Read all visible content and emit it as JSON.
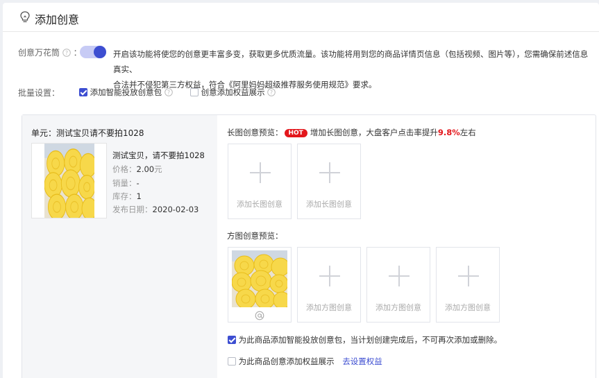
{
  "header": {
    "title": "添加创意",
    "icon": "lightbulb-icon"
  },
  "kaleidoscope": {
    "label": "创意万花筒",
    "suffix": "：",
    "enabled": true,
    "desc_line1": "开启该功能将使您的创意更丰富多变，获取更多优质流量。该功能将用到您的商品详情页信息（包括视频、图片等），您需确保前述信息真实、",
    "desc_line2": "合法并不侵犯第三方权益，符合《阿里妈妈超级推荐服务使用规范》要求。"
  },
  "batch": {
    "label": "批量设置：",
    "option1": {
      "label": "添加智能投放创意包",
      "checked": true
    },
    "option2": {
      "label": "创意添加权益展示",
      "checked": false
    }
  },
  "unit": {
    "title": "单元：测试宝贝请不要拍1028",
    "product": {
      "name": "测试宝贝，请不要拍1028",
      "price_label": "价格：",
      "price_value": "2.00",
      "price_unit": "元",
      "sales_label": "销量：",
      "sales_value": "-",
      "stock_label": "库存：",
      "stock_value": "1",
      "date_label": "发布日期：",
      "date_value": "2020-02-03"
    }
  },
  "long_preview": {
    "title": "长图创意预览：",
    "badge": "HOT",
    "tip_pre": "增加长图创意，大盘客户点击率提升",
    "tip_value": "9.8%",
    "tip_post": "左右",
    "slots": [
      "添加长图创意",
      "添加长图创意"
    ]
  },
  "square_preview": {
    "title": "方图创意预览：",
    "slots": [
      "添加方图创意",
      "添加方图创意",
      "添加方图创意"
    ]
  },
  "footer_options": {
    "option1": {
      "label": "为此商品添加智能投放创意包，当计划创建完成后，不可再次添加或删除。",
      "checked": true
    },
    "option2": {
      "label": "为此商品创意添加权益展示",
      "checked": false,
      "link": "去设置权益"
    }
  },
  "colors": {
    "accent": "#3d4ed1",
    "hot": "#e3171c",
    "panel_bg": "#f5f6f8"
  }
}
